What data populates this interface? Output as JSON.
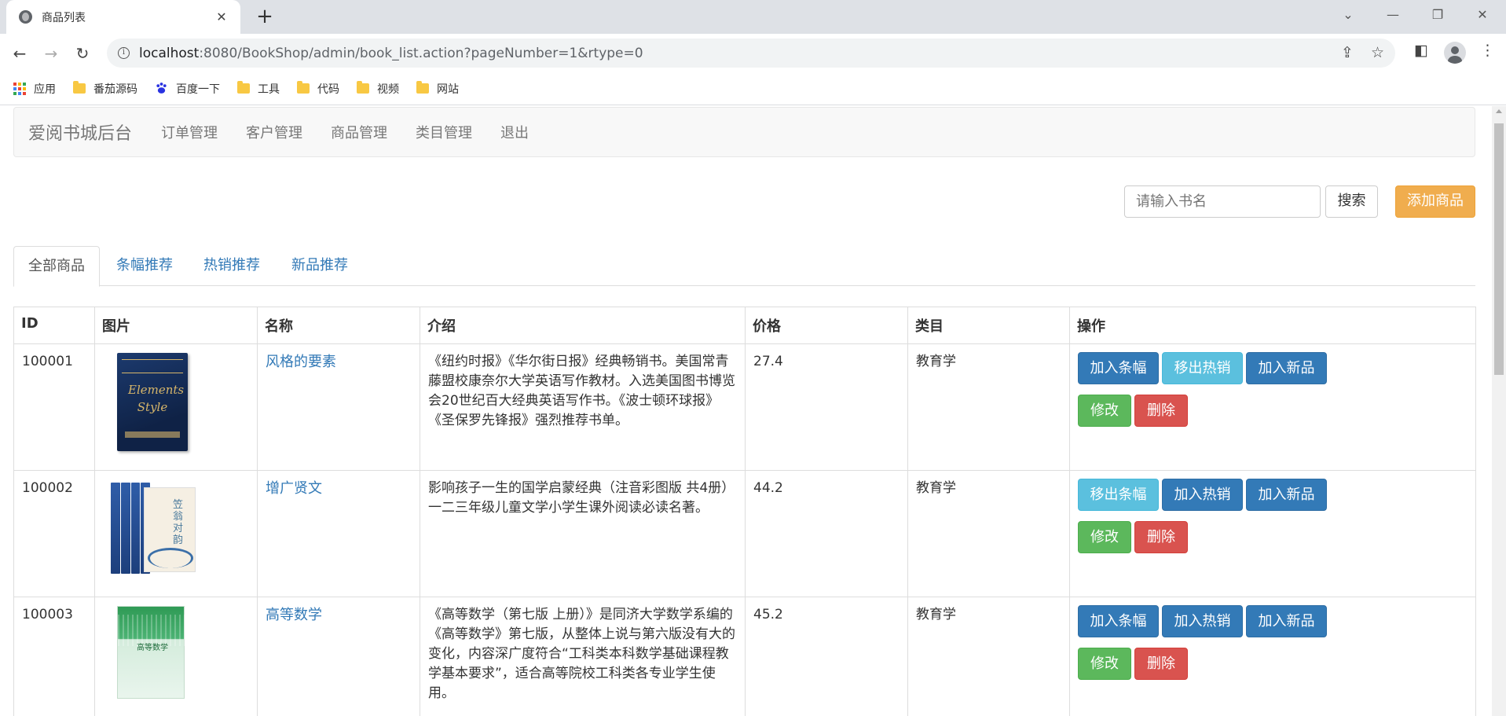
{
  "browser": {
    "tab_title": "商品列表",
    "url_host": "localhost",
    "url_path": ":8080/BookShop/admin/book_list.action?pageNumber=1&rtype=0",
    "bookmarks": [
      "应用",
      "番茄源码",
      "百度一下",
      "工具",
      "代码",
      "视频",
      "网站"
    ]
  },
  "navbar": {
    "brand": "爱阅书城后台",
    "links": [
      "订单管理",
      "客户管理",
      "商品管理",
      "类目管理",
      "退出"
    ]
  },
  "search": {
    "placeholder": "请输入书名",
    "button": "搜索",
    "add_button": "添加商品"
  },
  "tabs": [
    "全部商品",
    "条幅推荐",
    "热销推荐",
    "新品推荐"
  ],
  "table": {
    "headers": [
      "ID",
      "图片",
      "名称",
      "介绍",
      "价格",
      "类目",
      "操作"
    ],
    "rows": [
      {
        "id": "100001",
        "name": "风格的要素",
        "desc": "《纽约时报》《华尔街日报》经典畅销书。美国常青藤盟校康奈尔大学英语写作教材。入选美国图书博览会20世纪百大经典英语写作书。《波士顿环球报》《圣保罗先锋报》强烈推荐书单。",
        "price": "27.4",
        "category": "教育学",
        "actions": [
          "加入条幅",
          "移出热销",
          "加入新品"
        ],
        "edit": "修改",
        "delete": "删除",
        "cover_text": "Elements Style"
      },
      {
        "id": "100002",
        "name": "增广贤文",
        "desc": "影响孩子一生的国学启蒙经典（注音彩图版 共4册）一二三年级儿童文学小学生课外阅读必读名著。",
        "price": "44.2",
        "category": "教育学",
        "actions": [
          "移出条幅",
          "加入热销",
          "加入新品"
        ],
        "edit": "修改",
        "delete": "删除",
        "cover_text": "笠翁对韵"
      },
      {
        "id": "100003",
        "name": "高等数学",
        "desc": "《高等数学（第七版 上册）》是同济大学数学系编的《高等数学》第七版，从整体上说与第六版没有大的变化，内容深广度符合“工科类本科数学基础课程教学基本要求”，适合高等院校工科类各专业学生使用。",
        "price": "45.2",
        "category": "教育学",
        "actions": [
          "加入条幅",
          "加入热销",
          "加入新品"
        ],
        "edit": "修改",
        "delete": "删除",
        "cover_text": "高等数学"
      }
    ]
  },
  "colors": {
    "primary": "#337ab7",
    "info": "#5bc0de",
    "success": "#5cb85c",
    "danger": "#d9534f",
    "warning": "#f0ad4e"
  }
}
